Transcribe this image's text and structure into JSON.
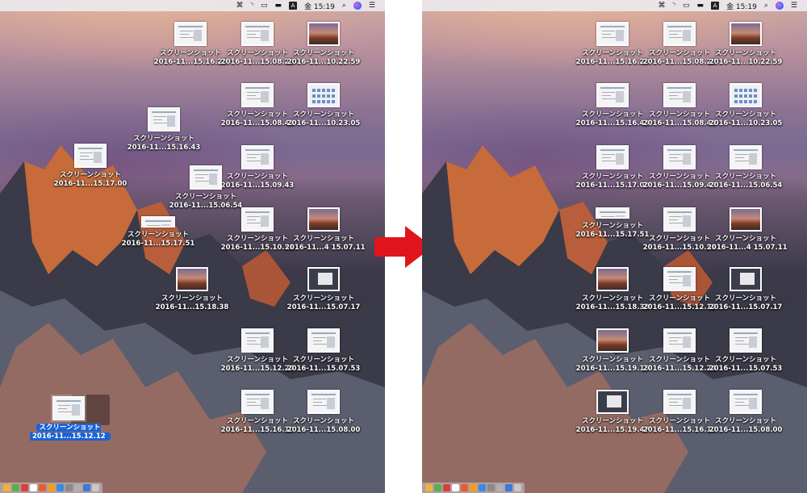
{
  "menubar": {
    "items": [
      {
        "name": "command-icon",
        "glyph": "⌘"
      },
      {
        "name": "wifi-icon",
        "glyph": "◝"
      },
      {
        "name": "airplay-icon",
        "glyph": "▭"
      },
      {
        "name": "battery-icon",
        "glyph": "▬"
      }
    ],
    "input_label": "A",
    "clock": "金 15:19",
    "search_glyph": "⌕",
    "list_glyph": "☰"
  },
  "desktop": {
    "label_name": "スクリーンショット",
    "left_icons": [
      {
        "date": "2016-11...15.16.26",
        "kind": "doc"
      },
      {
        "date": "2016-11...15.08.28",
        "kind": "doc"
      },
      {
        "date": "2016-11...10.22.59",
        "kind": "photo"
      },
      {
        "date": "2016-11...15.16.43",
        "kind": "doc"
      },
      {
        "date": "2016-11...15.08.41",
        "kind": "doc"
      },
      {
        "date": "2016-11...10.23.05",
        "kind": "grid"
      },
      {
        "date": "2016-11...15.17.00",
        "kind": "doc"
      },
      {
        "date": "2016-11...15.09.43",
        "kind": "doc"
      },
      {
        "date": "2016-11...15.06.54",
        "kind": "doc"
      },
      {
        "date": "2016-11...15.17.51",
        "kind": "wide"
      },
      {
        "date": "2016-11...15.10.51",
        "kind": "doc"
      },
      {
        "date": "2016-11...4 15.07.11",
        "kind": "photo"
      },
      {
        "date": "2016-11...15.18.38",
        "kind": "photo"
      },
      {
        "date": "2016-11...15.07.17",
        "kind": "dark"
      },
      {
        "date": "2016-11...15.12.24",
        "kind": "doc"
      },
      {
        "date": "2016-11...15.07.53",
        "kind": "doc"
      },
      {
        "date": "2016-11...15.16.10",
        "kind": "doc"
      },
      {
        "date": "2016-11...15.08.00",
        "kind": "doc"
      },
      {
        "date": "2016-11...15.12.12",
        "kind": "doc",
        "selected": true
      }
    ],
    "right_icons": [
      {
        "date": "2016-11...15.16.26",
        "kind": "doc"
      },
      {
        "date": "2016-11...15.08.28",
        "kind": "doc"
      },
      {
        "date": "2016-11...10.22.59",
        "kind": "photo"
      },
      {
        "date": "2016-11...15.16.43",
        "kind": "doc"
      },
      {
        "date": "2016-11...15.08.41",
        "kind": "doc"
      },
      {
        "date": "2016-11...10.23.05",
        "kind": "grid"
      },
      {
        "date": "2016-11...15.17.00",
        "kind": "doc"
      },
      {
        "date": "2016-11...15.09.43",
        "kind": "doc"
      },
      {
        "date": "2016-11...15.06.54",
        "kind": "doc"
      },
      {
        "date": "2016-11...15.17.51",
        "kind": "wide"
      },
      {
        "date": "2016-11...15.10.51",
        "kind": "doc"
      },
      {
        "date": "2016-11...4 15.07.11",
        "kind": "photo"
      },
      {
        "date": "2016-11...15.18.38",
        "kind": "photo"
      },
      {
        "date": "2016-11...15.12.12",
        "kind": "doc"
      },
      {
        "date": "2016-11...15.07.17",
        "kind": "dark"
      },
      {
        "date": "2016-11...15.19.15",
        "kind": "photo"
      },
      {
        "date": "2016-11...15.12.24",
        "kind": "doc"
      },
      {
        "date": "2016-11...15.07.53",
        "kind": "doc"
      },
      {
        "date": "2016-11...15.19.47",
        "kind": "dark"
      },
      {
        "date": "2016-11...15.16.10",
        "kind": "doc"
      },
      {
        "date": "2016-11...15.08.00",
        "kind": "doc"
      }
    ]
  },
  "colors": {
    "arrow": "#e0141c",
    "selection": "#1a62d6"
  },
  "dock_colors": [
    "#f0b040",
    "#5ab04a",
    "#d84040",
    "#ffffff",
    "#e06030",
    "#f0a020",
    "#3a8ae0",
    "#8a8a8a",
    "#b0b0b0",
    "#3a7ad8",
    "#c8c8c8"
  ]
}
